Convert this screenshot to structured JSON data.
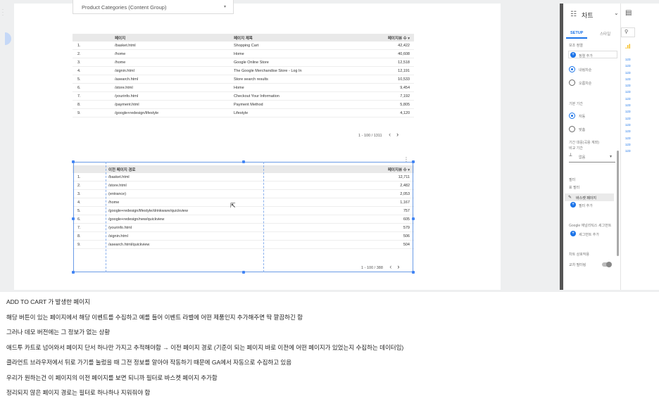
{
  "filter_control": {
    "label": "Product Categories (Content Group)"
  },
  "table1": {
    "headers": [
      "페이지",
      "페이지 제목",
      "페이지뷰 수 ▾"
    ],
    "rows": [
      [
        "1.",
        "/basket.html",
        "Shopping Cart",
        "42,422"
      ],
      [
        "2.",
        "/home",
        "Home",
        "40,608"
      ],
      [
        "3.",
        "/home",
        "Google Online Store",
        "12,518"
      ],
      [
        "4.",
        "/signin.html",
        "The Google Merchandise Store - Log In",
        "12,191"
      ],
      [
        "5.",
        "/asearch.html",
        "Store search results",
        "10,533"
      ],
      [
        "6.",
        "/store.html",
        "Home",
        "9,454"
      ],
      [
        "7.",
        "/yourinfo.html",
        "Checkout Your Information",
        "7,192"
      ],
      [
        "8.",
        "/payment.html",
        "Payment Method",
        "5,805"
      ],
      [
        "9.",
        "/google+redesign/lifestyle",
        "Lifestyle",
        "4,120"
      ]
    ],
    "pager": "1 - 100 / 1311"
  },
  "table2": {
    "headers": [
      "이전 페이지 경로",
      "페이지뷰 수 ▾"
    ],
    "rows": [
      [
        "1.",
        "/basket.html",
        "12,711"
      ],
      [
        "2.",
        "/store.html",
        "2,482"
      ],
      [
        "3.",
        "(entrance)",
        "2,053"
      ],
      [
        "4.",
        "/home",
        "1,167"
      ],
      [
        "5.",
        "/google+redesign/lifestyle/drinkware/quickview",
        "757"
      ],
      [
        "6.",
        "/google+redesign/new/quickview",
        "605"
      ],
      [
        "7.",
        "/yourinfo.html",
        "579"
      ],
      [
        "8.",
        "/signin.html",
        "506"
      ],
      [
        "9.",
        "/asearch.html/quickview",
        "504"
      ]
    ],
    "pager": "1 - 100 / 388"
  },
  "panel": {
    "title": "차트",
    "tabs": [
      "SETUP",
      "스타일"
    ],
    "sort_secondary": "보조 정렬",
    "add_sort": "정렬 추가",
    "ascending": "내림차순",
    "descending": "오름차순",
    "date_range": "기본 기간",
    "auto": "자동",
    "custom": "맞춤",
    "compare_label": "기간 대응(곡용 계좌)",
    "compare_sub": "비교 기간",
    "compare_value": "없음",
    "filter_title": "필터",
    "table_filter": "표 필터",
    "filter_chip": "바스켓 페이지",
    "add_filter": "필터 추가",
    "segment_title": "Google 애널리틱스 세그먼트",
    "add_segment": "세그먼트 추가",
    "interaction_title": "차트 상호작용",
    "cross_filter": "교차 필터링",
    "rail_items": [
      "123",
      "123",
      "123",
      "123",
      "123",
      "123",
      "123",
      "123",
      "123",
      "123",
      "123",
      "123",
      "123",
      "123",
      "123"
    ]
  },
  "notes": [
    "ADD TO CART 가 발생한 페이지",
    "해당 버튼이 있는 페이지에서 해당 이벤트를 수집하고 예를 들어 이벤트 라벨에 어떤 제품인지 추가해주면 딱 깔끔하긴 함",
    "그러나 데모 버전에는 그 정보가 없는 상황",
    "애드투 카트로 넘어와서 페이지 단서 하나만 가지고 추적해야함 → 이전 페이지 경로 (기준이 되는 페이지 바로 이전에 어떤 페이지가 있었는지 수집하는 데이터임)",
    "클라언트 브라우저에서 뒤로 가기를 눌렀을 때 그전 정보를 알아야 작동하기 때문에 GA에서 자동으로 수집하고 있음",
    "우리가 원하는건 이 페이지의 이전 페이지를 보면 되니까 필터로 바스켓 페이지 추가함",
    "정리되지 않은 페이지 경로는 필터로 하나하나 지워줘야 함"
  ]
}
